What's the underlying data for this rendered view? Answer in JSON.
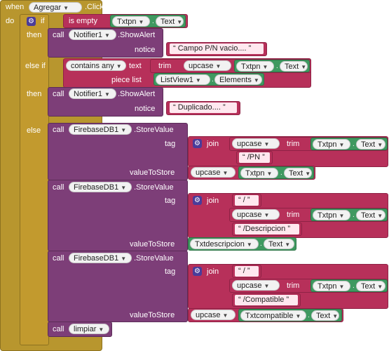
{
  "event": {
    "when": "when",
    "component": "Agregar",
    "event": ".Click",
    "do": "do"
  },
  "if_block": {
    "if": "if",
    "then": "then",
    "else_if": "else if",
    "else": "else"
  },
  "is_empty": {
    "label": "is empty",
    "comp": "Txtpn",
    "prop": "Text"
  },
  "call1": {
    "call": "call",
    "comp": "Notifier1",
    "method": ".ShowAlert",
    "notice": "notice",
    "text": "Campo P/N vacio...."
  },
  "contains": {
    "op": "contains any",
    "text_lbl": "text",
    "trim": "trim",
    "upcase": "upcase",
    "comp": "Txtpn",
    "prop": "Text",
    "piece": "piece list",
    "list_comp": "ListView1",
    "list_prop": "Elements"
  },
  "call2": {
    "call": "call",
    "comp": "Notifier1",
    "method": ".ShowAlert",
    "notice": "notice",
    "text": "Duplicado...."
  },
  "store1": {
    "call": "call",
    "comp": "FirebaseDB1",
    "method": ".StoreValue",
    "tag": "tag",
    "join": "join",
    "upcase": "upcase",
    "trim": "trim",
    "tcomp": "Txtpn",
    "tprop": "Text",
    "suffix": "/PN",
    "vts": "valueToStore",
    "vup": "upcase",
    "vcomp": "Txtpn",
    "vprop": "Text"
  },
  "store2": {
    "call": "call",
    "comp": "FirebaseDB1",
    "method": ".StoreValue",
    "tag": "tag",
    "join": "join",
    "slash": "/",
    "upcase": "upcase",
    "trim": "trim",
    "tcomp": "Txtpn",
    "tprop": "Text",
    "suffix": "/Descripcion",
    "vts": "valueToStore",
    "vcomp": "Txtdescripcion",
    "vprop": "Text"
  },
  "store3": {
    "call": "call",
    "comp": "FirebaseDB1",
    "method": ".StoreValue",
    "tag": "tag",
    "join": "join",
    "slash": "/",
    "upcase": "upcase",
    "trim": "trim",
    "tcomp": "Txtpn",
    "tprop": "Text",
    "suffix": "/Compatible",
    "vts": "valueToStore",
    "vup": "upcase",
    "vcomp": "Txtcompatible",
    "vprop": "Text"
  },
  "call_limpiar": {
    "call": "call",
    "proc": "limpiar"
  }
}
